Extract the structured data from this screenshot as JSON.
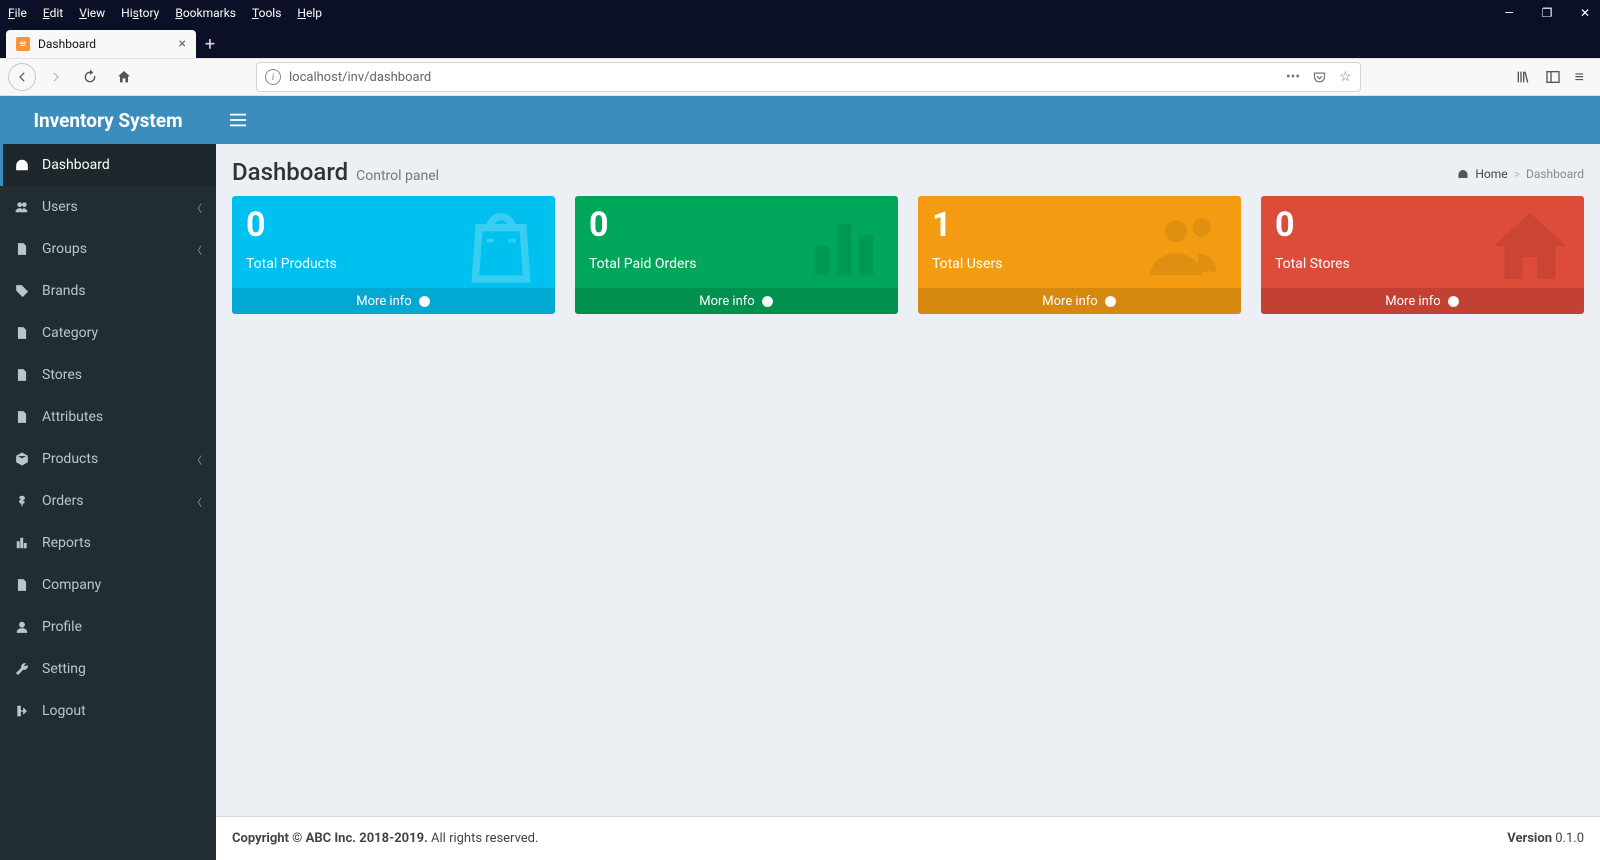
{
  "os_menu": [
    "File",
    "Edit",
    "View",
    "History",
    "Bookmarks",
    "Tools",
    "Help"
  ],
  "browser": {
    "tab_title": "Dashboard",
    "url": "localhost/inv/dashboard"
  },
  "brand": "Inventory System",
  "sidebar": {
    "items": [
      {
        "label": "Dashboard",
        "icon": "dashboard",
        "active": true
      },
      {
        "label": "Users",
        "icon": "users",
        "expandable": true
      },
      {
        "label": "Groups",
        "icon": "file",
        "expandable": true
      },
      {
        "label": "Brands",
        "icon": "tag"
      },
      {
        "label": "Category",
        "icon": "file"
      },
      {
        "label": "Stores",
        "icon": "file"
      },
      {
        "label": "Attributes",
        "icon": "file"
      },
      {
        "label": "Products",
        "icon": "cube",
        "expandable": true
      },
      {
        "label": "Orders",
        "icon": "dollar",
        "expandable": true
      },
      {
        "label": "Reports",
        "icon": "bars"
      },
      {
        "label": "Company",
        "icon": "file"
      },
      {
        "label": "Profile",
        "icon": "user"
      },
      {
        "label": "Setting",
        "icon": "wrench"
      },
      {
        "label": "Logout",
        "icon": "logout"
      }
    ]
  },
  "header": {
    "title": "Dashboard",
    "subtitle": "Control panel",
    "breadcrumb_home": "Home",
    "breadcrumb_current": "Dashboard"
  },
  "cards": [
    {
      "value": "0",
      "label": "Total Products",
      "more": "More info",
      "color": "c-aqua",
      "icon": "bag"
    },
    {
      "value": "0",
      "label": "Total Paid Orders",
      "more": "More info",
      "color": "c-green",
      "icon": "stats"
    },
    {
      "value": "1",
      "label": "Total Users",
      "more": "More info",
      "color": "c-yellow",
      "icon": "people"
    },
    {
      "value": "0",
      "label": "Total Stores",
      "more": "More info",
      "color": "c-red",
      "icon": "home"
    }
  ],
  "footer": {
    "copyright_strong": "Copyright © ABC Inc. 2018-2019.",
    "copyright_rest": " All rights reserved.",
    "version_label": "Version",
    "version_value": " 0.1.0"
  }
}
